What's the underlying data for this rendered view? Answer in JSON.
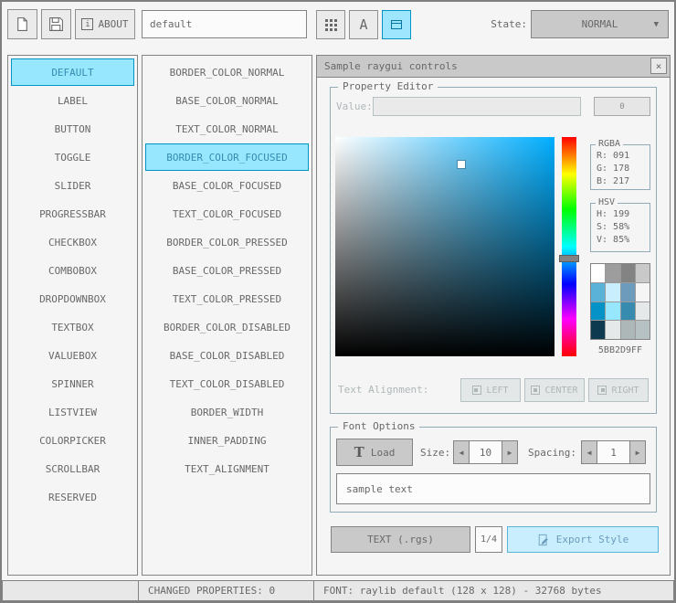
{
  "toolbar": {
    "about_label": "ABOUT",
    "about_icon_glyph": "i",
    "style_name_value": "default",
    "font_button_glyph": "A",
    "state_label": "State:",
    "state_value": "NORMAL",
    "state_arrow_glyph": "▼"
  },
  "controls_list": {
    "items": [
      "DEFAULT",
      "LABEL",
      "BUTTON",
      "TOGGLE",
      "SLIDER",
      "PROGRESSBAR",
      "CHECKBOX",
      "COMBOBOX",
      "DROPDOWNBOX",
      "TEXTBOX",
      "VALUEBOX",
      "SPINNER",
      "LISTVIEW",
      "COLORPICKER",
      "SCROLLBAR",
      "RESERVED"
    ],
    "selected_index": 0
  },
  "properties_list": {
    "items": [
      "BORDER_COLOR_NORMAL",
      "BASE_COLOR_NORMAL",
      "TEXT_COLOR_NORMAL",
      "BORDER_COLOR_FOCUSED",
      "BASE_COLOR_FOCUSED",
      "TEXT_COLOR_FOCUSED",
      "BORDER_COLOR_PRESSED",
      "BASE_COLOR_PRESSED",
      "TEXT_COLOR_PRESSED",
      "BORDER_COLOR_DISABLED",
      "BASE_COLOR_DISABLED",
      "TEXT_COLOR_DISABLED",
      "BORDER_WIDTH",
      "INNER_PADDING",
      "TEXT_ALIGNMENT"
    ],
    "selected_index": 3
  },
  "sample_window": {
    "title": "Sample raygui controls",
    "close_glyph": "×",
    "property_editor": {
      "label": "Property Editor",
      "value_label": "Value:",
      "value_text": "",
      "value_button_label": "0",
      "rgba_label": "RGBA",
      "rgba_lines": [
        "R: 091",
        "G: 178",
        "B: 217"
      ],
      "hsv_label": "HSV",
      "hsv_lines": [
        "H: 199",
        "S: 58%",
        "V: 85%"
      ],
      "palette_colors": [
        "#ffffff",
        "#9d9d9d",
        "#838383",
        "#c9c9c9",
        "#5bb2d9",
        "#c9effe",
        "#6c9bbc",
        "#f5f5f5",
        "#0492c7",
        "#97e8ff",
        "#368baf",
        "#e6e9e9",
        "#0e3a50",
        "#e6e9e9",
        "#aeb7b8",
        "#b5c1c2"
      ],
      "hex_value": "5BB2D9FF",
      "text_alignment_label": "Text Alignment:",
      "alignment_buttons": [
        "LEFT",
        "CENTER",
        "RIGHT"
      ]
    },
    "font_options": {
      "label": "Font Options",
      "load_icon_glyph": "T",
      "load_label": "Load",
      "size_label": "Size:",
      "size_value": "10",
      "spacing_label": "Spacing:",
      "spacing_value": "1",
      "spinner_left_glyph": "◀",
      "spinner_right_glyph": "▶",
      "sample_text": "sample text"
    },
    "export_bar": {
      "format_button": "TEXT (.rgs)",
      "ratio_button": "1/4",
      "export_button": "Export Style"
    }
  },
  "statusbar": {
    "changed_properties": "CHANGED PROPERTIES: 0",
    "font_info": "FONT: raylib default (128 x 128) - 32768 bytes"
  },
  "colors": {
    "background": "#f5f5f5",
    "border": "#838383",
    "text": "#686868",
    "disabled_text": "#aeb7b8",
    "selected_fill": "#97e8ff",
    "selected_border": "#0492c7",
    "selected_text": "#368baf",
    "focused_fill": "#c9effe",
    "focused_border": "#5bb2d9",
    "focused_text": "#6c9bbc",
    "current_color_hex": "#5bb2d9"
  }
}
